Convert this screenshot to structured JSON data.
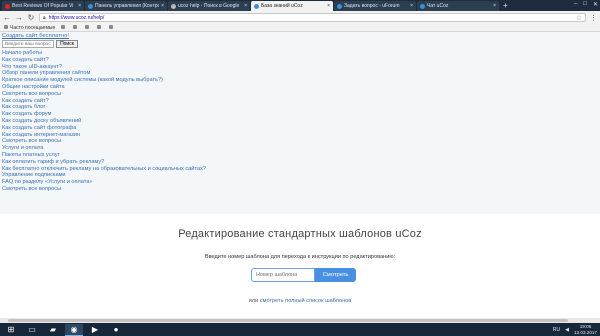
{
  "browser": {
    "tabs": [
      {
        "label": "Best Reviews Of Popular Vi",
        "color": "#e62117",
        "active": false
      },
      {
        "label": "Панель управления (Контро",
        "color": "#3b8fd9",
        "active": false
      },
      {
        "label": "ucoz help - Поиск в Google",
        "color": "#bbbbbb",
        "active": false
      },
      {
        "label": "База знаний uCoz",
        "color": "#3b8fd9",
        "active": true
      },
      {
        "label": "Задать вопрос - uForum",
        "color": "#3b8fd9",
        "active": false
      },
      {
        "label": "Чат uCoz",
        "color": "#3b8fd9",
        "active": false
      }
    ],
    "url": "https://www.ucoz.ru/help/",
    "bookmarks": [
      "Часто посещаемые",
      "",
      "",
      "",
      "",
      ""
    ]
  },
  "page": {
    "create_link": "Создать сайт бесплатно!",
    "search_placeholder": "Введите ваш вопрос",
    "search_button": "Поиск",
    "nav_items": [
      "Начало работы",
      "Как создать сайт?",
      "Что такое uID-аккаунт?",
      "Обзор панели управления сайтом",
      "Краткое описание модулей системы (какой модуль выбрать?)",
      "Общие настройки сайта",
      "Смотреть все вопросы",
      "Как создать сайт?",
      "Как создать блог",
      "Как создать форум",
      "Как создать доску объявлений",
      "Как создать сайт фотографа",
      "Как создать интернет-магазин",
      "Смотреть все вопросы",
      "Услуги и оплата",
      "Пакеты платных услуг",
      "Как оплатить тариф и убрать рекламу?",
      "Как бесплатно отключить рекламу на образовательных и социальных сайтах?",
      "Управление подписками",
      "FAQ по разделу «Услуги и оплата»",
      "Смотреть все вопросы"
    ],
    "main_title": "Редактирование стандартных шаблонов uCoz",
    "instruction": "Введите номер шаблона для перехода к инструкции по редактированию:",
    "template_placeholder": "Номер шаблона",
    "view_button": "Смотреть",
    "alt_prefix": "или",
    "alt_link": "смотреть полный список шаблонов"
  },
  "taskbar": {
    "apps": [
      "start-icon",
      "file-explorer-icon",
      "folder-icon",
      "chrome-icon",
      "media-icon",
      "firefox-icon"
    ],
    "language": "RU",
    "time": "19:06",
    "date": "13.03.2017"
  }
}
